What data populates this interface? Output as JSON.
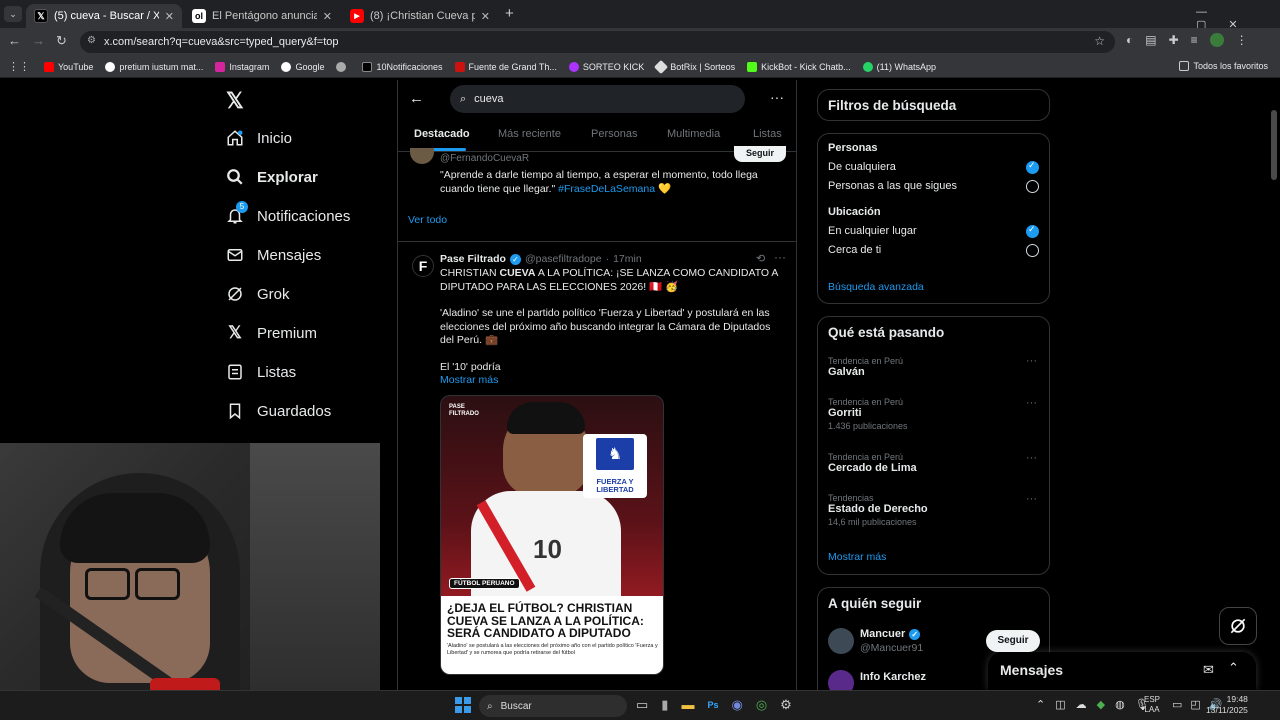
{
  "browser": {
    "tabs": [
      {
        "title": "(5) cueva - Buscar / X",
        "favicon": "x-icon"
      },
      {
        "title": "El Pentágono anuncia la operaci",
        "favicon": "news-icon"
      },
      {
        "title": "(8) ¡Christian Cueva postulará a",
        "favicon": "youtube-icon"
      }
    ],
    "url": "x.com/search?q=cueva&src=typed_query&f=top",
    "bookmarks": [
      "YouTube",
      "pretium iustum mat...",
      "Instagram",
      "Google",
      "10Notificaciones",
      "Fuente de Grand Th...",
      "SORTEO KICK",
      "BotRix | Sorteos",
      "KickBot - Kick Chatb...",
      "(11) WhatsApp"
    ],
    "all_bookmarks": "Todos los favoritos"
  },
  "nav": {
    "items": [
      {
        "label": "Inicio",
        "icon": "home-icon"
      },
      {
        "label": "Explorar",
        "icon": "search-icon"
      },
      {
        "label": "Notificaciones",
        "icon": "bell-icon",
        "badge": "5"
      },
      {
        "label": "Mensajes",
        "icon": "mail-icon"
      },
      {
        "label": "Grok",
        "icon": "grok-icon"
      },
      {
        "label": "Premium",
        "icon": "x-icon"
      },
      {
        "label": "Listas",
        "icon": "list-icon"
      },
      {
        "label": "Guardados",
        "icon": "bookmark-icon"
      }
    ]
  },
  "search": {
    "query": "cueva",
    "tabs": [
      "Destacado",
      "Más reciente",
      "Personas",
      "Multimedia",
      "Listas"
    ],
    "active_tab": "Destacado"
  },
  "prev_tweet": {
    "handle": "@FernandoCuevaR",
    "follow_label": "Seguir",
    "text": "\"Aprende a darle tiempo al tiempo, a esperar el momento, todo llega cuando tiene que llegar.\"",
    "hashtag": "#FraseDeLaSemana",
    "ver_todo": "Ver todo"
  },
  "tweet": {
    "name": "Pase Filtrado",
    "handle": "@pasefiltradope",
    "time": "17min",
    "line1_a": "CHRISTIAN ",
    "line1_b": "CUEVA",
    "line1_c": " A LA POLÍTICA: ¡SE LANZA COMO CANDIDATO A DIPUTADO PARA LAS ELECCIONES 2026! 🇵🇪 🥳",
    "line2": "'Aladino' se une el partido político 'Fuerza y Libertad' y postulará en las elecciones del próximo año buscando integrar la Cámara de Diputados del Perú. 💼",
    "line3": "El '10' podría",
    "show_more": "Mostrar más",
    "image": {
      "brand": "PASE FILTRADO",
      "party": "FUERZA Y LIBERTAD",
      "jersey_number": "10",
      "tag": "FÚTBOL PERUANO",
      "headline": "¿DEJA EL FÚTBOL? CHRISTIAN CUEVA SE LANZA A LA POLÍTICA: SERÁ CANDIDATO A DIPUTADO",
      "caption": "'Aladino' se postulará a las elecciones del próximo año con el partido político 'Fuerza y Libertad' y se rumorea que podría retirarse del fútbol"
    }
  },
  "filters": {
    "title": "Filtros de búsqueda",
    "people_title": "Personas",
    "people_options": [
      "De cualquiera",
      "Personas a las que sigues"
    ],
    "location_title": "Ubicación",
    "location_options": [
      "En cualquier lugar",
      "Cerca de ti"
    ],
    "advanced": "Búsqueda avanzada"
  },
  "trends": {
    "title": "Qué está pasando",
    "items": [
      {
        "context": "Tendencia en Perú",
        "name": "Galván",
        "count": ""
      },
      {
        "context": "Tendencia en Perú",
        "name": "Gorriti",
        "count": "1.436 publicaciones"
      },
      {
        "context": "Tendencia en Perú",
        "name": "Cercado de Lima",
        "count": ""
      },
      {
        "context": "Tendencias",
        "name": "Estado de Derecho",
        "count": "14,6 mil publicaciones"
      }
    ],
    "show_more": "Mostrar más"
  },
  "follow": {
    "title": "A quién seguir",
    "users": [
      {
        "name": "Mancuer",
        "handle": "@Mancuer91",
        "button": "Seguir"
      },
      {
        "name": "Info Karchez",
        "handle": ""
      }
    ]
  },
  "messages_drawer": "Mensajes",
  "taskbar": {
    "search_placeholder": "Buscar",
    "lang": "ESP",
    "lang2": "LAA",
    "time": "19:48",
    "date": "13/11/2025"
  },
  "colors": {
    "accent": "#1d9bf0",
    "bg": "#000000",
    "muted": "#71767b"
  }
}
